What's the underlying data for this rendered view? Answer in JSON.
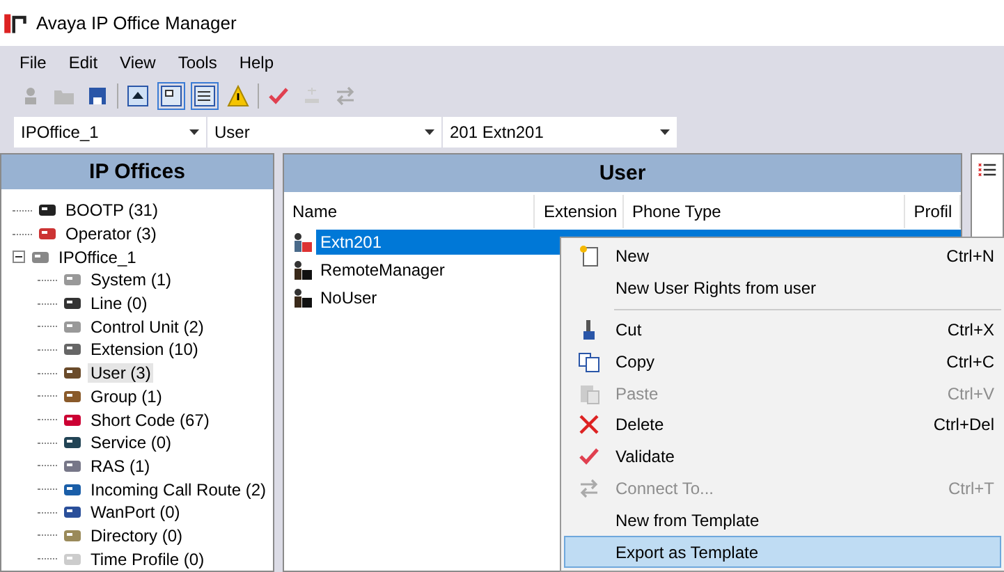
{
  "window": {
    "title": "Avaya IP Office Manager"
  },
  "menu": [
    "File",
    "Edit",
    "View",
    "Tools",
    "Help"
  ],
  "selectors": [
    "IPOffice_1",
    "User",
    "201 Extn201"
  ],
  "tree": {
    "title": "IP Offices",
    "items": [
      {
        "label": "BOOTP (31)",
        "selected": false
      },
      {
        "label": "Operator (3)",
        "selected": false
      },
      {
        "label": "IPOffice_1",
        "selected": false,
        "expanded": true,
        "children": [
          {
            "label": "System (1)",
            "selected": false
          },
          {
            "label": "Line (0)",
            "selected": false
          },
          {
            "label": "Control Unit (2)",
            "selected": false
          },
          {
            "label": "Extension (10)",
            "selected": false
          },
          {
            "label": "User (3)",
            "selected": true
          },
          {
            "label": "Group (1)",
            "selected": false
          },
          {
            "label": "Short Code (67)",
            "selected": false
          },
          {
            "label": "Service (0)",
            "selected": false
          },
          {
            "label": "RAS (1)",
            "selected": false
          },
          {
            "label": "Incoming Call Route (2)",
            "selected": false
          },
          {
            "label": "WanPort (0)",
            "selected": false
          },
          {
            "label": "Directory (0)",
            "selected": false
          },
          {
            "label": "Time Profile (0)",
            "selected": false
          }
        ]
      }
    ]
  },
  "list": {
    "title": "User",
    "columns": [
      "Name",
      "Extension",
      "Phone Type",
      "Profil"
    ],
    "rows": [
      {
        "name": "Extn201",
        "selected": true
      },
      {
        "name": "RemoteManager",
        "selected": false
      },
      {
        "name": "NoUser",
        "selected": false
      }
    ]
  },
  "context_menu": [
    {
      "kind": "item",
      "label": "New",
      "shortcut": "Ctrl+N",
      "disabled": false,
      "selected": false
    },
    {
      "kind": "item",
      "label": "New User Rights from user",
      "disabled": false,
      "selected": false
    },
    {
      "kind": "separator"
    },
    {
      "kind": "item",
      "label": "Cut",
      "shortcut": "Ctrl+X",
      "disabled": false,
      "selected": false
    },
    {
      "kind": "item",
      "label": "Copy",
      "shortcut": "Ctrl+C",
      "disabled": false,
      "selected": false
    },
    {
      "kind": "item",
      "label": "Paste",
      "shortcut": "Ctrl+V",
      "disabled": true,
      "selected": false
    },
    {
      "kind": "item",
      "label": "Delete",
      "shortcut": "Ctrl+Del",
      "disabled": false,
      "selected": false
    },
    {
      "kind": "item",
      "label": "Validate",
      "disabled": false,
      "selected": false
    },
    {
      "kind": "item",
      "label": "Connect To...",
      "shortcut": "Ctrl+T",
      "disabled": true,
      "selected": false
    },
    {
      "kind": "item",
      "label": "New from Template",
      "disabled": false,
      "selected": false
    },
    {
      "kind": "item",
      "label": "Export as Template",
      "disabled": false,
      "selected": true
    }
  ]
}
